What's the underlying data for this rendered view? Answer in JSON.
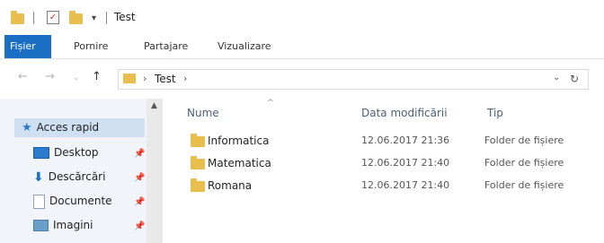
{
  "window": {
    "title": "Test"
  },
  "ribbon": {
    "tabs": [
      "Fișier",
      "Pornire",
      "Partajare",
      "Vizualizare"
    ],
    "active": "Fișier"
  },
  "address": {
    "path": [
      "Test"
    ],
    "refresh_icon": "refresh-icon",
    "dropdown_icon": "chevron-down-icon"
  },
  "nav": {
    "items": [
      {
        "label": "Acces rapid",
        "icon": "star-icon"
      },
      {
        "label": "Desktop",
        "icon": "desktop-icon"
      },
      {
        "label": "Descărcări",
        "icon": "download-icon"
      },
      {
        "label": "Documente",
        "icon": "document-icon"
      },
      {
        "label": "Imagini",
        "icon": "image-icon"
      }
    ]
  },
  "columns": {
    "name": "Nume",
    "date": "Data modificării",
    "type": "Tip"
  },
  "files": [
    {
      "name": "Informatica",
      "date": "12.06.2017 21:36",
      "type": "Folder de fișiere"
    },
    {
      "name": "Matematica",
      "date": "12.06.2017 21:40",
      "type": "Folder de fișiere"
    },
    {
      "name": "Romana",
      "date": "12.06.2017 21:40",
      "type": "Folder de fișiere"
    }
  ],
  "colors": {
    "accent": "#1a6fc4",
    "folder": "#e8bf4f",
    "selection": "#cfe0f3"
  }
}
